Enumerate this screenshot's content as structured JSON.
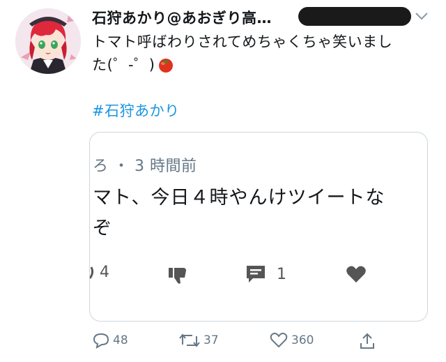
{
  "tweet": {
    "author_name": "石狩あかり@あおぎり高…",
    "text_line1": "トマト呼ばわりされてめちゃくちゃ笑いまし",
    "text_line2": "た(゜-゜)",
    "emoji": "tomato-emoji",
    "hashtag": "#石狩あかり"
  },
  "quoted": {
    "meta": "ろ ・ 3 時間前",
    "text_line1": "マト、今日４時やんけツイートな",
    "text_line2": "ぞ",
    "reply_count": "4",
    "comment_count": "1"
  },
  "actions": {
    "reply_count": "48",
    "retweet_count": "37",
    "like_count": "360"
  },
  "colors": {
    "link": "#1b95e0",
    "text": "#14171a",
    "muted": "#657786",
    "border": "#ccd6dd"
  }
}
